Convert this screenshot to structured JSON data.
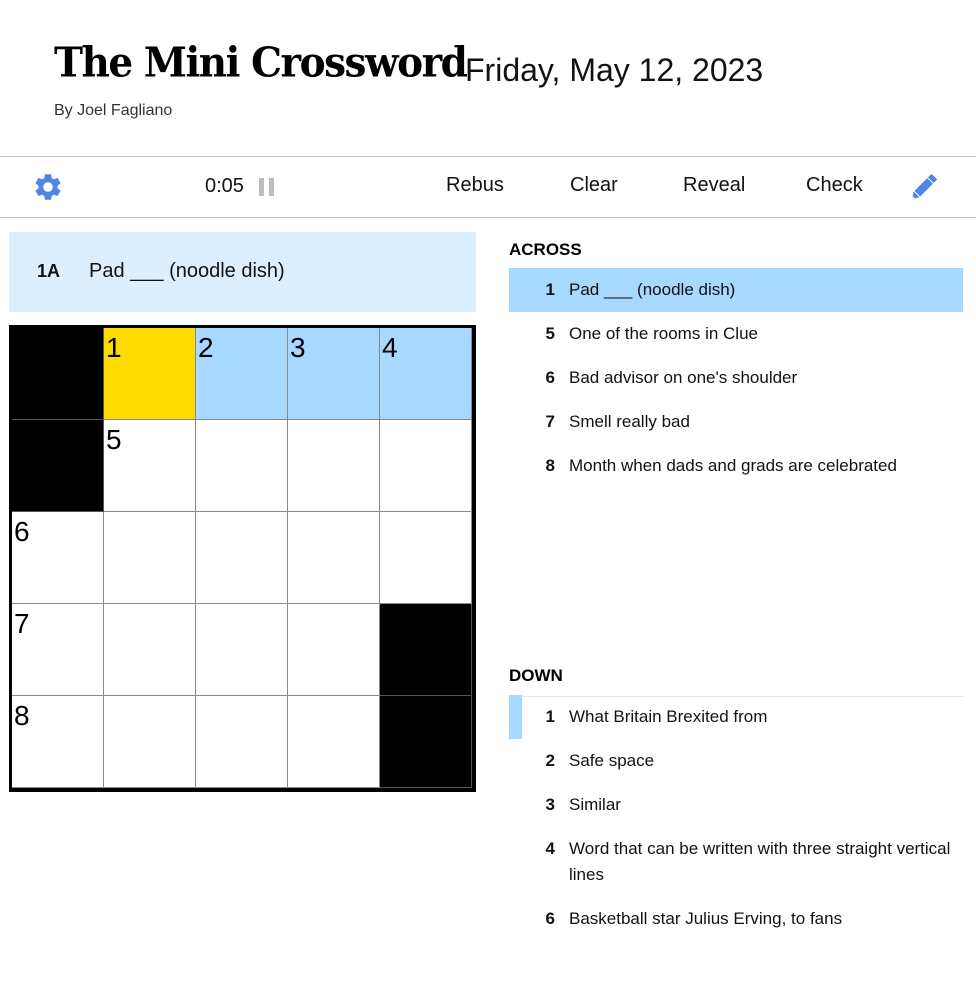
{
  "header": {
    "title": "The Mini Crossword",
    "date": "Friday, May 12, 2023",
    "byline": "By Joel Fagliano"
  },
  "toolbar": {
    "settings_icon": "gear-icon",
    "timer": "0:05",
    "pause_icon": "pause-icon",
    "buttons": [
      "Rebus",
      "Clear",
      "Reveal",
      "Check"
    ],
    "pencil_icon": "pencil-icon"
  },
  "current_clue": {
    "label": "1A",
    "text": "Pad ___ (noodle dish)"
  },
  "colors": {
    "accent": "#4f85e5",
    "active_cell": "#ffda00",
    "word_highlight": "#a7d8ff",
    "clue_bar": "#dcefff"
  },
  "grid": {
    "rows": 5,
    "cols": 5,
    "active": [
      0,
      1
    ],
    "direction": "across",
    "cells": [
      [
        {
          "block": true
        },
        {
          "num": "1"
        },
        {
          "num": "2"
        },
        {
          "num": "3"
        },
        {
          "num": "4"
        }
      ],
      [
        {
          "block": true
        },
        {
          "num": "5"
        },
        {},
        {},
        {}
      ],
      [
        {
          "num": "6"
        },
        {},
        {},
        {},
        {}
      ],
      [
        {
          "num": "7"
        },
        {},
        {},
        {},
        {
          "block": true
        }
      ],
      [
        {
          "num": "8"
        },
        {},
        {},
        {},
        {
          "block": true
        }
      ]
    ]
  },
  "clues": {
    "across_title": "ACROSS",
    "down_title": "DOWN",
    "across": [
      {
        "num": "1",
        "text": "Pad ___ (noodle dish)",
        "state": "highlighted"
      },
      {
        "num": "5",
        "text": "One of the rooms in Clue"
      },
      {
        "num": "6",
        "text": "Bad advisor on one's shoulder"
      },
      {
        "num": "7",
        "text": "Smell really bad"
      },
      {
        "num": "8",
        "text": "Month when dads and grads are celebrated"
      }
    ],
    "down": [
      {
        "num": "1",
        "text": "What Britain Brexited from",
        "state": "crossing"
      },
      {
        "num": "2",
        "text": "Safe space"
      },
      {
        "num": "3",
        "text": "Similar"
      },
      {
        "num": "4",
        "text": "Word that can be written with three straight vertical lines"
      },
      {
        "num": "6",
        "text": "Basketball star Julius Erving, to fans"
      }
    ]
  }
}
